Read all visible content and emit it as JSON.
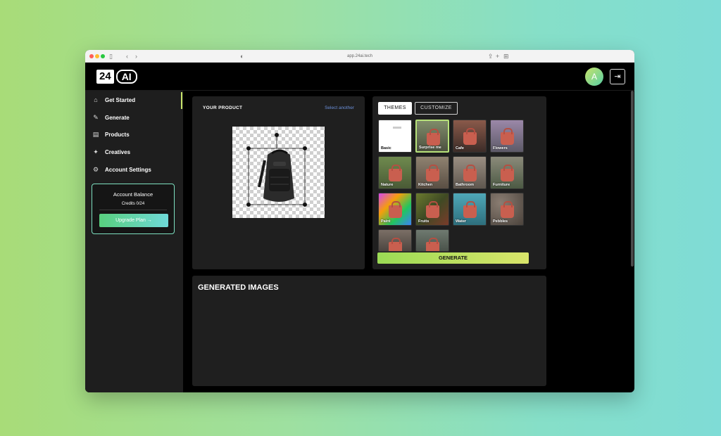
{
  "browser": {
    "url": "app.24ai.tech",
    "icons": [
      "sidebar-toggle-icon",
      "back-icon",
      "forward-icon",
      "shield-icon",
      "share-icon",
      "new-tab-icon",
      "tabs-icon"
    ]
  },
  "header": {
    "logo_left": "24",
    "logo_right": "AI",
    "avatar_initial": "A"
  },
  "sidebar": {
    "items": [
      {
        "label": "Get Started",
        "icon": "home-icon",
        "glyph": "⌂"
      },
      {
        "label": "Generate",
        "icon": "magic-wand-icon",
        "glyph": "✎"
      },
      {
        "label": "Products",
        "icon": "briefcase-icon",
        "glyph": "▤"
      },
      {
        "label": "Creatives",
        "icon": "sparkles-icon",
        "glyph": "✦"
      },
      {
        "label": "Account Settings",
        "icon": "gear-icon",
        "glyph": "⚙"
      }
    ],
    "balance": {
      "title": "Account Balance",
      "credits": "Credits 0/24",
      "upgrade_label": "Upgrade Plan →"
    }
  },
  "product": {
    "title": "YOUR PRODUCT",
    "select_another": "Select another"
  },
  "themes": {
    "tabs": [
      "THEMES",
      "CUSTOMIZE"
    ],
    "selected_tab": "THEMES",
    "selected_theme": "Surprise me",
    "items": [
      "Basic",
      "Surprise me",
      "Cafe",
      "Flowers",
      "Nature",
      "Kitchen",
      "Bathroom",
      "Furniture",
      "Paint",
      "Fruits",
      "Water",
      "Pebbles",
      "",
      ""
    ],
    "generate_label": "GENERATE"
  },
  "generated": {
    "title": "GENERATED IMAGES"
  },
  "colors": {
    "accent": "#c7e36a",
    "balance_border": "#7de0c0",
    "link": "#6b8fd8",
    "bag": "#c95f4f"
  }
}
